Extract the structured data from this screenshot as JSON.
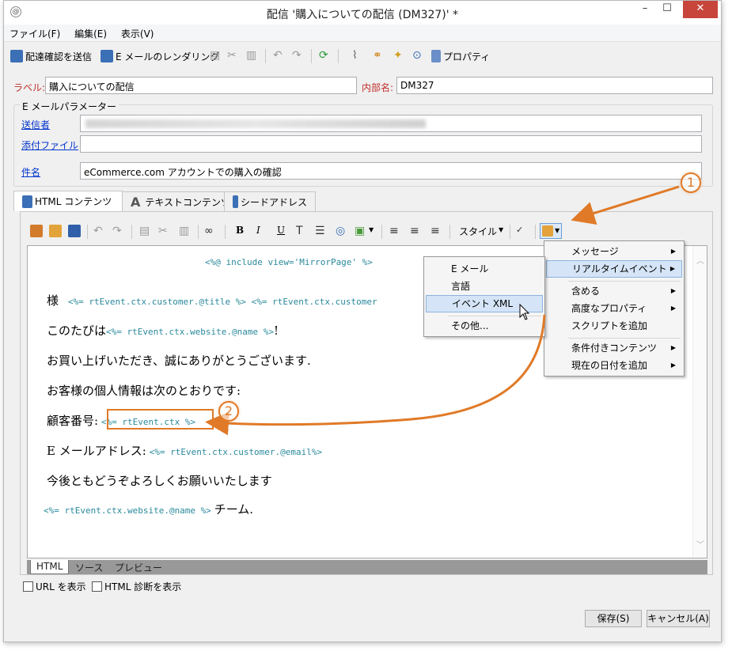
{
  "window": {
    "title": "配信 '購入についての配信 (DM327)' *",
    "min": "–",
    "max": "☐",
    "close": "✕"
  },
  "menu": {
    "file": "ファイル(F)",
    "edit": "編集(E)",
    "view": "表示(V)"
  },
  "toolbar": {
    "send_proof": "配達確認を送信",
    "email_render": "E メールのレンダリング",
    "properties": "プロパティ"
  },
  "form": {
    "label_label": "ラベル:",
    "label_value": "購入についての配信",
    "internal_label": "内部名:",
    "internal_value": "DM327",
    "group_title": "E メールパラメーター",
    "sender_label": "送信者",
    "attachment_label": "添付ファイル",
    "subject_label": "件名",
    "subject_value": "eCommerce.com アカウントでの購入の確認"
  },
  "tabs": {
    "html": "HTML コンテンツ",
    "text": "テキストコンテンツ",
    "seed": "シードアドレス"
  },
  "editor_toolbar": {
    "bold": "B",
    "italic": "I",
    "underline": "U",
    "style": "スタイル"
  },
  "content": {
    "include": "<%@ include view='MirrorPage' %>",
    "l1_text": "様",
    "l1_code": "<%= rtEvent.ctx.customer.@title %> <%= rtEvent.ctx.customer",
    "l2_text": "このたびは",
    "l2_code": "<%= rtEvent.ctx.website.@name %>",
    "l2_end": "!",
    "l3": "お買い上げいただき、誠にありがとうございます.",
    "l4": "お客様の個人情報は次のとおりです:",
    "l5_text": "顧客番号:",
    "l5_code": "<%= rtEvent.ctx %>",
    "l6_text": "E メールアドレス:",
    "l6_code": "<%= rtEvent.ctx.customer.@email%>",
    "l7": "今後ともどうぞよろしくお願いいたします",
    "l8_code": "<%= rtEvent.ctx.website.@name %>",
    "l8_text": "チーム."
  },
  "bottom_tabs": {
    "html": "HTML",
    "source": "ソース",
    "preview": "プレビュー"
  },
  "checkboxes": {
    "show_url": "URL を表示",
    "html_diag": "HTML 診断を表示"
  },
  "buttons": {
    "save": "保存(S)",
    "cancel": "キャンセル(A)"
  },
  "context_menu": {
    "items": [
      "メッセージ",
      "リアルタイムイベント",
      "含める",
      "高度なプロパティ",
      "スクリプトを追加",
      "条件付きコンテンツ",
      "現在の日付を追加"
    ]
  },
  "submenu": {
    "items": [
      "E メール",
      "言語",
      "イベント XML",
      "その他..."
    ]
  },
  "callouts": {
    "one": "1",
    "two": "2"
  },
  "colors": {
    "accent": "#e07a28",
    "link": "#0033cc",
    "code": "#2a8a9c"
  }
}
